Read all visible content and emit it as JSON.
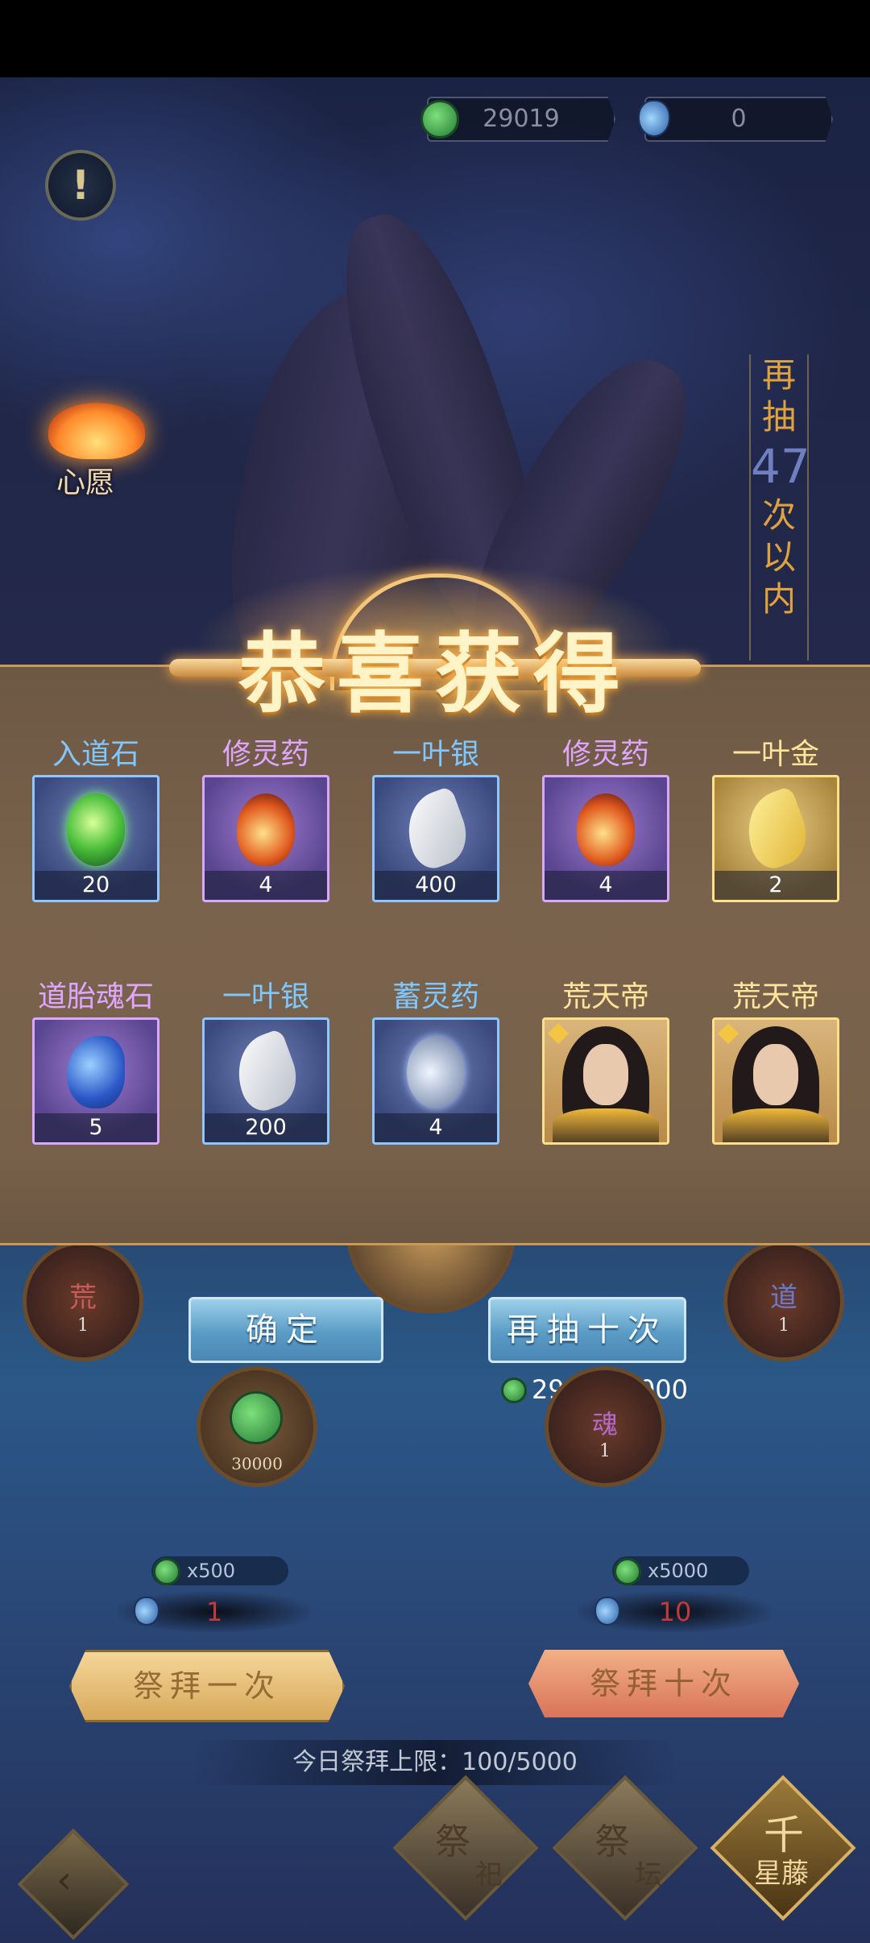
{
  "currency": {
    "jade": "29019",
    "potion": "0"
  },
  "info_button": "!",
  "wish_label": "心愿",
  "draw_counter": {
    "prefix": [
      "再",
      "抽"
    ],
    "count": "47",
    "suffix": [
      "次",
      "以",
      "内"
    ]
  },
  "reward_title": "恭喜获得",
  "rewards": [
    {
      "name": "入道石",
      "count": "20",
      "quality": "blue",
      "icon": "green-stone-icon"
    },
    {
      "name": "修灵药",
      "count": "4",
      "quality": "purple",
      "icon": "gourd-icon"
    },
    {
      "name": "一叶银",
      "count": "400",
      "quality": "blue",
      "icon": "silver-leaf-icon"
    },
    {
      "name": "修灵药",
      "count": "4",
      "quality": "purple",
      "icon": "gourd-icon"
    },
    {
      "name": "一叶金",
      "count": "2",
      "quality": "gold",
      "icon": "gold-leaf-icon"
    },
    {
      "name": "道胎魂石",
      "count": "5",
      "quality": "purple",
      "icon": "soul-stone-icon"
    },
    {
      "name": "一叶银",
      "count": "200",
      "quality": "blue",
      "icon": "silver-leaf-icon"
    },
    {
      "name": "蓄灵药",
      "count": "4",
      "quality": "blue",
      "icon": "vial-icon"
    },
    {
      "name": "荒天帝",
      "count": "",
      "quality": "gold",
      "icon": "hero-portrait-icon"
    },
    {
      "name": "荒天帝",
      "count": "",
      "quality": "gold",
      "icon": "hero-portrait-icon"
    }
  ],
  "altar": {
    "left_seal": {
      "char": "荒",
      "num": "1"
    },
    "right_seal": {
      "char": "道",
      "num": "1"
    },
    "jade_coin_value": "30000",
    "soul_seal": {
      "char": "魂",
      "num": "1"
    }
  },
  "confirm_label": "确定",
  "draw_ten_label": "再抽十次",
  "draw_ten_cost": "29019/5000",
  "worship_once": {
    "price": "x500",
    "count": "1",
    "label": "祭拜一次"
  },
  "worship_ten": {
    "price": "x5000",
    "count": "10",
    "label": "祭拜十次"
  },
  "daily_limit": "今日祭拜上限：100/5000",
  "bottom_nav": [
    {
      "top": "祭",
      "bottom": "祀"
    },
    {
      "top": "祭",
      "bottom": "坛"
    },
    {
      "top": "千",
      "bottom": "星藤"
    }
  ],
  "colors": {
    "accent_gold": "#e0a23c",
    "panel_brown": "#78614a",
    "button_blue": "#5a9cc6"
  }
}
